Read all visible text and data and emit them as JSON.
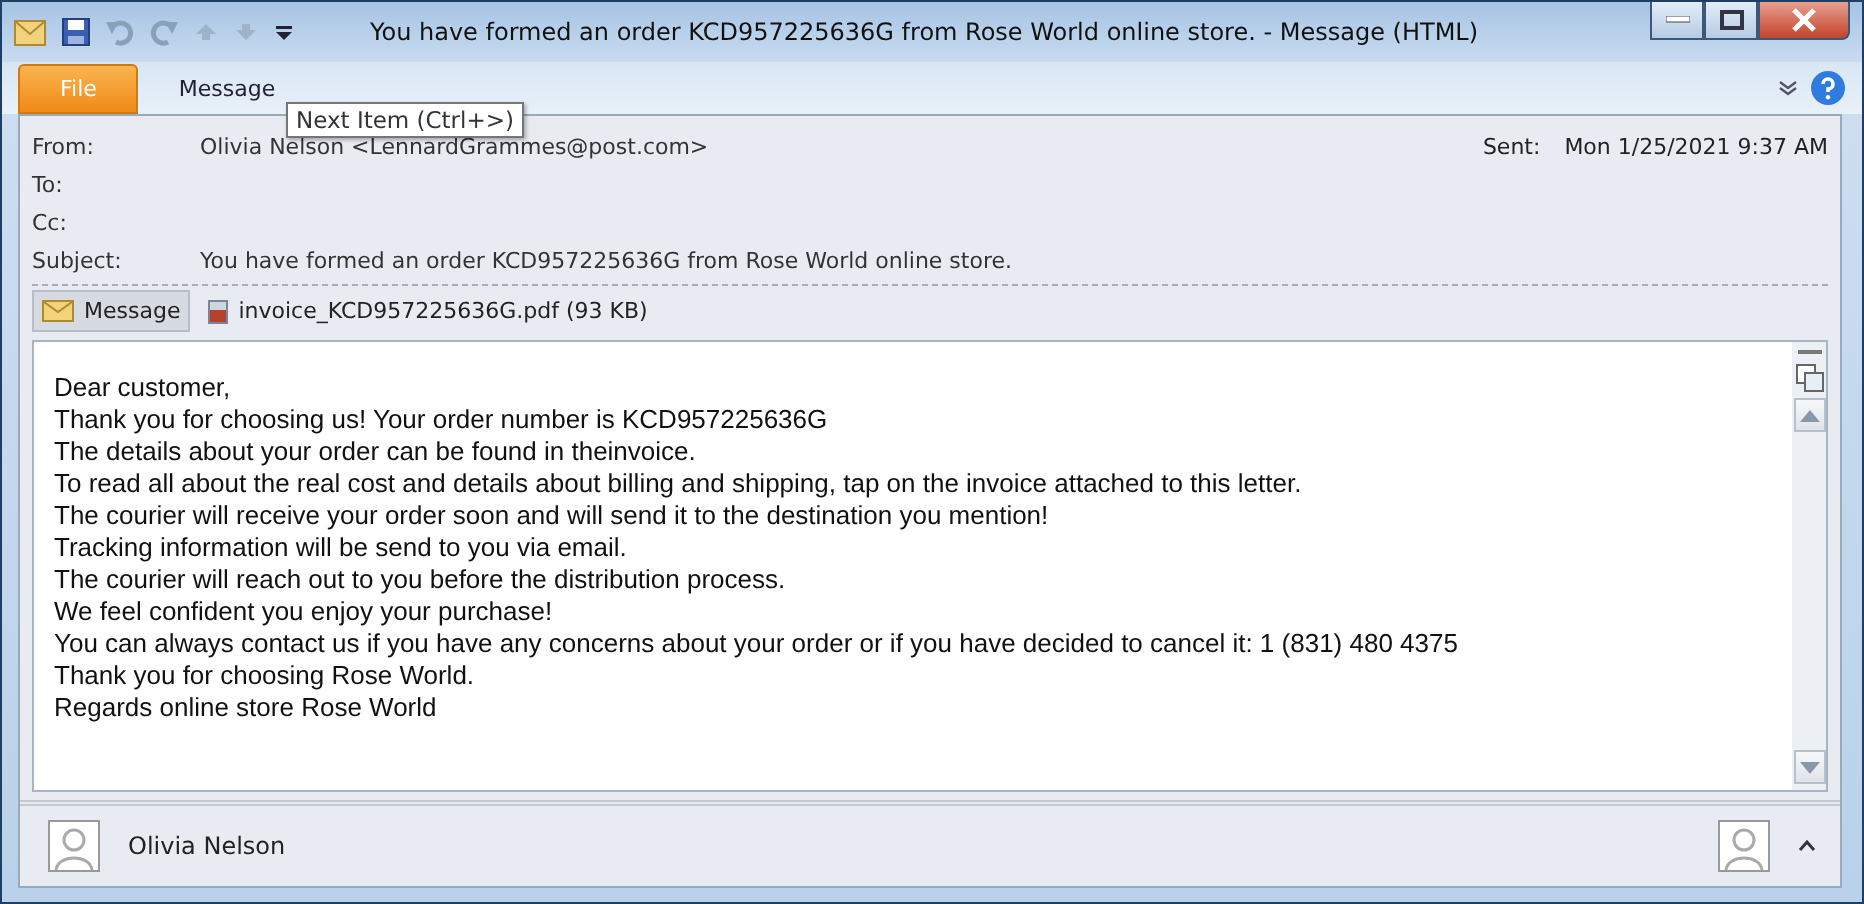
{
  "window": {
    "title": "You have formed an order KCD957225636G from Rose World online store.  -  Message (HTML)"
  },
  "tabs": [
    {
      "label": "File",
      "kind": "file"
    },
    {
      "label": "Message",
      "kind": "plain"
    }
  ],
  "tooltip": "Next Item (Ctrl+>)",
  "header": {
    "fields": [
      {
        "label": "From:",
        "value": "Olivia Nelson <LennardGrammes@post.com>"
      },
      {
        "label": "To:"
      },
      {
        "label": "Cc:"
      },
      {
        "label": "Subject:",
        "value": "You have formed an order KCD957225636G from Rose World online store."
      }
    ],
    "sent": {
      "label": "Sent:",
      "value": "Mon 1/25/2021 9:37 AM"
    }
  },
  "attachments": [
    {
      "label": "Message",
      "selected": true,
      "kind": "message"
    },
    {
      "label": "invoice_KCD957225636G.pdf (93 KB)",
      "selected": false,
      "kind": "pdf"
    }
  ],
  "body": [
    "Dear customer,",
    "Thank you for choosing us! Your order number is KCD957225636G",
    "The details about your order can be found in theinvoice.",
    "To read all about the real cost and details about billing and shipping, tap on the invoice attached to this letter.",
    "The courier will receive your order soon and will send it to the destination you mention!",
    "Tracking information will be send to you via email.",
    "The courier will reach out to you before the distribution process.",
    "We feel confident you enjoy your purchase!",
    "You can always contact us if you have any concerns about your order or if you have decided to cancel it: 1 (831) 480 4375",
    "Thank you for choosing Rose World.",
    "Regards online store Rose World"
  ],
  "people_pane": {
    "name": "Olivia Nelson"
  }
}
